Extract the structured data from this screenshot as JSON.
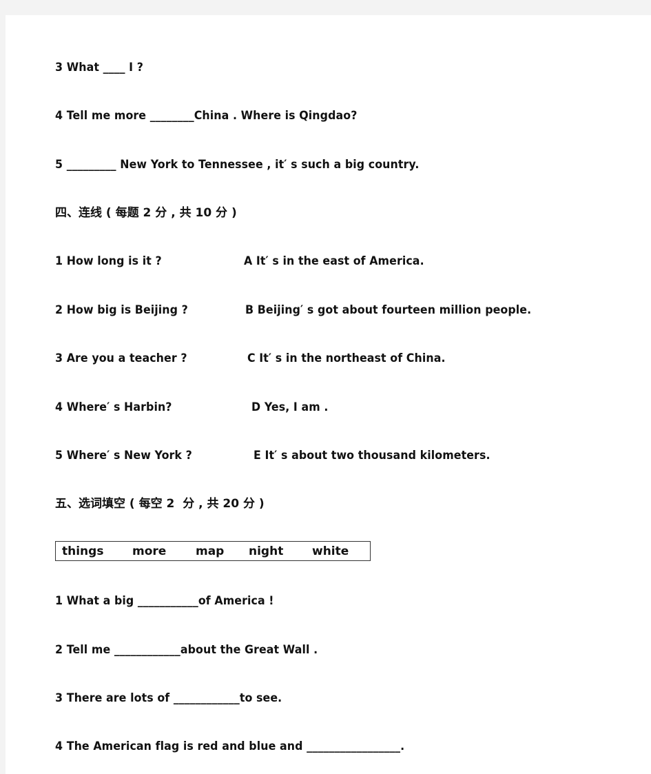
{
  "section3_tail": {
    "items": [
      {
        "text": "3 What ____ I ?"
      },
      {
        "text": "4 Tell me more ________China . Where is Qingdao?"
      },
      {
        "text": "5 _________ New York to Tennessee , it′ s such a big country."
      }
    ]
  },
  "section4": {
    "heading": "四、连线 ( 每题 2 分 , 共 10 分 )",
    "questions": [
      {
        "text": "1 How long is it ?"
      },
      {
        "text": "2 How big is Beijing ?"
      },
      {
        "text": "3 Are you a teacher ?"
      },
      {
        "text": "4 Where′ s Harbin?"
      },
      {
        "text": "5 Where′ s New York ?"
      }
    ],
    "answers": [
      {
        "text": "A It′ s in the east of America."
      },
      {
        "text": "B Beijing′ s got about fourteen million people."
      },
      {
        "text": "C It′ s in the northeast of China."
      },
      {
        "text": "D Yes, I am ."
      },
      {
        "text": "E It′ s about two thousand kilometers."
      }
    ]
  },
  "section5": {
    "heading": "五、选词填空 ( 每空 2  分 , 共 20 分 )",
    "word_bank": [
      "things",
      "more",
      "map",
      "night",
      "white"
    ],
    "items": [
      {
        "text": "1 What a big ___________of America !"
      },
      {
        "text": "2 Tell me ____________about the Great Wall ."
      },
      {
        "text": "3 There are lots of ____________to see."
      },
      {
        "text": "4 The American flag is red and blue and _________________."
      }
    ]
  }
}
